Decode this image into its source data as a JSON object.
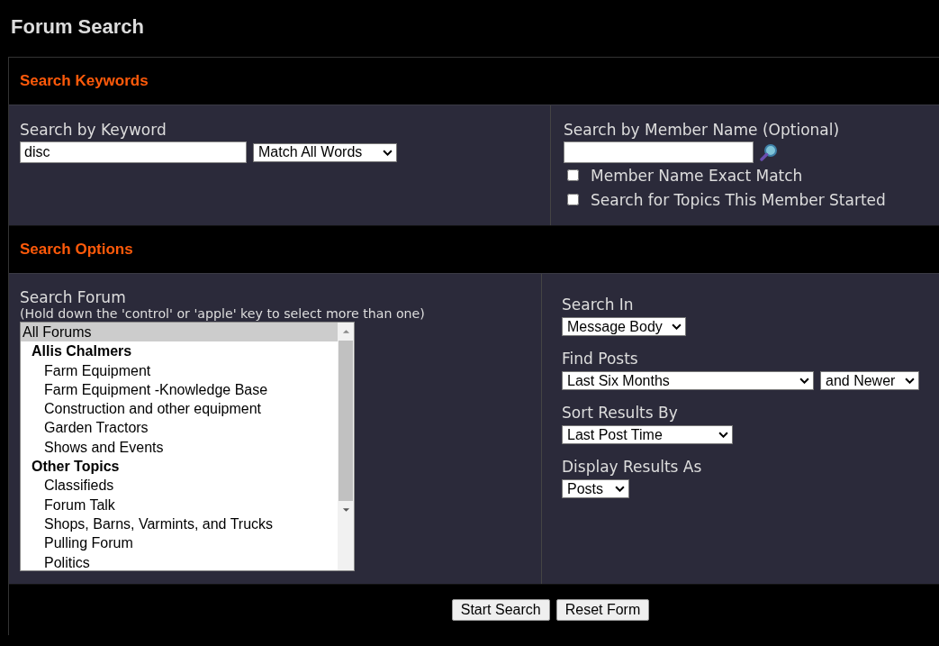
{
  "page_title": "Forum Search",
  "keywords_section": {
    "title": "Search Keywords",
    "keyword_label": "Search by Keyword",
    "keyword_value": "disc",
    "match_select": "Match All Words",
    "member_label": "Search by Member Name (Optional)",
    "options": [
      {
        "label": "Member Name Exact Match",
        "checked": false
      },
      {
        "label": "Search for Topics This Member Started",
        "checked": false
      }
    ]
  },
  "options_section": {
    "title": "Search Options",
    "forum_label": "Search Forum",
    "forum_hint": "(Hold down the 'control' or 'apple' key to select more than one)",
    "forums": [
      {
        "label": "All Forums",
        "selected": true,
        "children": [
          {
            "label": "Allis Chalmers",
            "selected": false,
            "children": [
              {
                "label": "Farm Equipment",
                "selected": false
              },
              {
                "label": "Farm Equipment -Knowledge Base",
                "selected": false
              },
              {
                "label": "Construction and other equipment",
                "selected": false
              },
              {
                "label": "Garden Tractors",
                "selected": false
              },
              {
                "label": "Shows and Events",
                "selected": false
              }
            ]
          },
          {
            "label": "Other Topics",
            "selected": false,
            "children": [
              {
                "label": "Classifieds",
                "selected": false
              },
              {
                "label": "Forum Talk",
                "selected": false
              },
              {
                "label": "Shops, Barns, Varmints, and Trucks",
                "selected": false
              },
              {
                "label": "Pulling Forum",
                "selected": false
              },
              {
                "label": "Politics",
                "selected": false
              }
            ]
          }
        ]
      }
    ],
    "fields": [
      {
        "label": "Search In",
        "selects": [
          "Message Body"
        ]
      },
      {
        "label": "Find Posts",
        "selects": [
          "Last Six Months",
          "and Newer"
        ]
      },
      {
        "label": "Sort Results By",
        "selects": [
          "Last Post Time"
        ]
      },
      {
        "label": "Display Results As",
        "selects": [
          "Posts"
        ]
      }
    ]
  },
  "buttons": [
    "Start Search",
    "Reset Form"
  ]
}
